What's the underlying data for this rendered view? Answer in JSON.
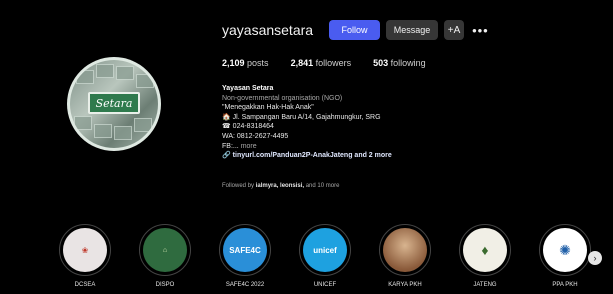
{
  "profile": {
    "username": "yayasansetara",
    "avatar_text": "Setara",
    "follow_label": "Follow",
    "message_label": "Message",
    "adduser_icon": "person-plus-icon",
    "more_label": "•••"
  },
  "stats": {
    "posts_count": "2,109",
    "posts_label": "posts",
    "followers_count": "2,841",
    "followers_label": "followers",
    "following_count": "503",
    "following_label": "following"
  },
  "bio": {
    "name": "Yayasan Setara",
    "category": "Non-governmental organisation (NGO)",
    "line1": "\"Menegakkan Hak-Hak Anak\"",
    "line2": "Jl. Sampangan Baru A/14, Gajahmungkur, SRG",
    "line3": "024-8318464",
    "line4": "WA: 0812-2627-4495",
    "line5": "FB:...",
    "more": "more",
    "link": "tinyurl.com/Panduan2P-AnakJateng and 2 more"
  },
  "followed_by": {
    "prefix": "Followed by",
    "users": "ialmyra, leonsisi,",
    "suffix": "and 10 more"
  },
  "highlights": [
    {
      "label": "DCSEA",
      "bg": "#e9e4e4",
      "text": ""
    },
    {
      "label": "DISPO",
      "bg": "#2f6b3f",
      "text": ""
    },
    {
      "label": "SAFE4C 2022",
      "bg": "#2a8fd8",
      "text": "SAFE4C"
    },
    {
      "label": "UNICEF",
      "bg": "#1ea1e0",
      "text": "unicef"
    },
    {
      "label": "KARYA PKH",
      "bg": "#c9a58a",
      "text": ""
    },
    {
      "label": "JATENG",
      "bg": "#f1efe6",
      "text": ""
    },
    {
      "label": "PPA PKH",
      "bg": "#ffffff",
      "text": ""
    }
  ],
  "colors": {
    "follow": "#4a5cf0",
    "secondary_button": "#363636",
    "background": "#000000"
  }
}
